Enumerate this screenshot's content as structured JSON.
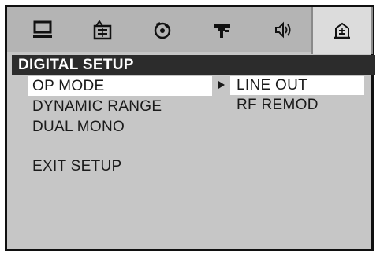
{
  "tabs": [
    {
      "icon": "monitor-icon",
      "active": false
    },
    {
      "icon": "language-icon",
      "active": false
    },
    {
      "icon": "disc-icon",
      "active": false
    },
    {
      "icon": "video-connector-icon",
      "active": false
    },
    {
      "icon": "speaker-icon",
      "active": false
    },
    {
      "icon": "digital-setup-icon",
      "active": true
    }
  ],
  "section": {
    "title": "DIGITAL SETUP"
  },
  "menu": {
    "items": [
      {
        "label": "OP MODE",
        "selected": true
      },
      {
        "label": "DYNAMIC RANGE",
        "selected": false
      },
      {
        "label": "DUAL MONO",
        "selected": false
      },
      {
        "label": "EXIT SETUP",
        "selected": false
      }
    ]
  },
  "submenu": {
    "items": [
      {
        "label": "LINE OUT",
        "selected": true
      },
      {
        "label": "RF REMOD",
        "selected": false
      }
    ]
  },
  "colors": {
    "background": "#c6c6c6",
    "tabbar": "#b4b4b4",
    "header": "#2c2c2c",
    "highlight": "#ffffff"
  }
}
